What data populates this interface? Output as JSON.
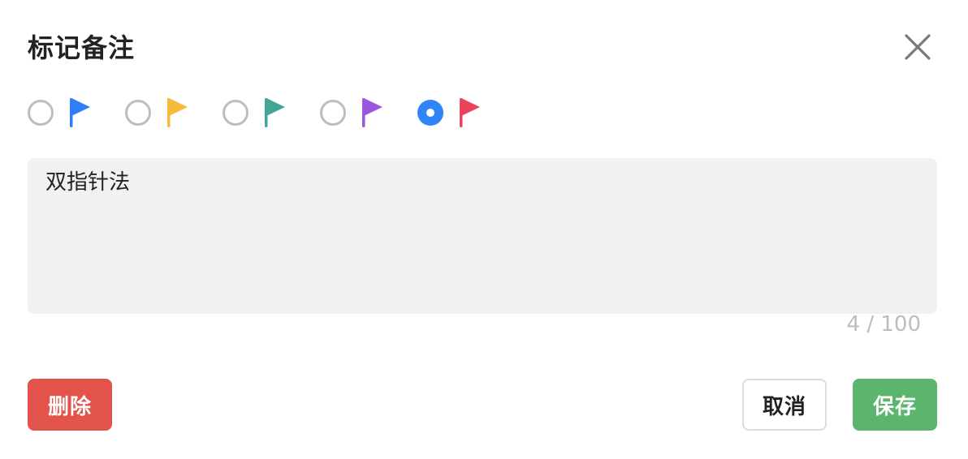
{
  "dialog": {
    "title": "标记备注",
    "close_icon": "close-icon"
  },
  "colors": [
    {
      "id": "blue",
      "flag_color": "#2d7ef7",
      "selected": false,
      "icon": "flag-icon"
    },
    {
      "id": "yellow",
      "flag_color": "#f5b93c",
      "selected": false,
      "icon": "flag-icon"
    },
    {
      "id": "teal",
      "flag_color": "#43a597",
      "selected": false,
      "icon": "flag-icon"
    },
    {
      "id": "purple",
      "flag_color": "#9b55e0",
      "selected": false,
      "icon": "flag-icon"
    },
    {
      "id": "red",
      "flag_color": "#e9445b",
      "selected": true,
      "icon": "flag-icon"
    }
  ],
  "note": {
    "value": "双指针法",
    "counter": "4 / 100"
  },
  "buttons": {
    "delete_label": "删除",
    "cancel_label": "取消",
    "save_label": "保存"
  },
  "theme": {
    "radio_selected": "#2f85f7",
    "delete_bg": "#e2534b",
    "save_bg": "#5cb56c",
    "textarea_bg": "#f1f1f3"
  }
}
